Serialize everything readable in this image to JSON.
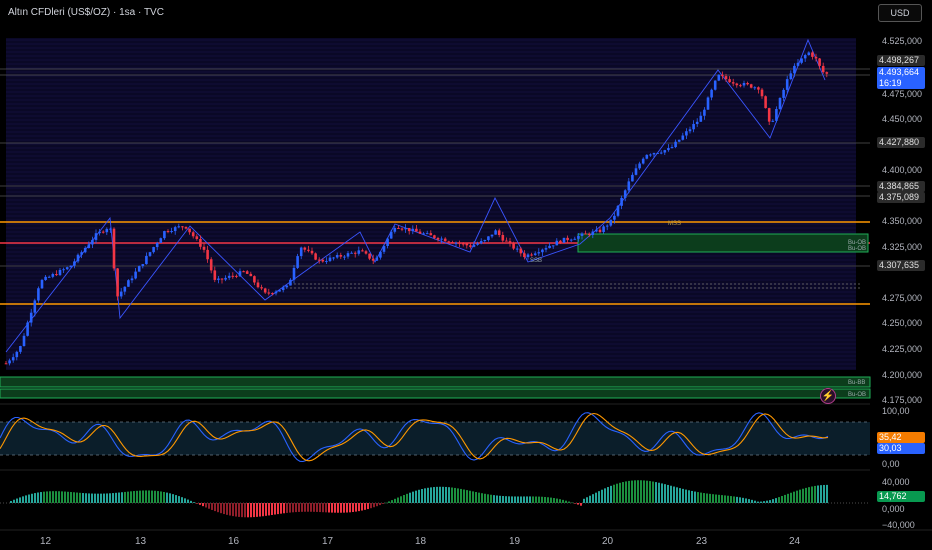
{
  "header": {
    "title": "Altın CFDleri (US$/OZ) · 1sa · TVC",
    "currency_button": "USD"
  },
  "price_axis": {
    "labels": [
      "4.525,000",
      "4.475,000",
      "4.450,000",
      "4.400,000",
      "4.350,000",
      "4.325,000",
      "4.275,000",
      "4.250,000",
      "4.225,000",
      "4.200,000",
      "4.175,000"
    ]
  },
  "price_tags": {
    "t1": "4.498,267",
    "t2": "4.493,664",
    "t2_time": "16:19",
    "t3": "4.427,880",
    "t4": "4.384,865",
    "t5": "4.375,089",
    "t6": "4.307,635"
  },
  "chart_labels": {
    "mss": "MSS",
    "bu_ob1": "Bu-OB",
    "bu_ob2": "Bu-OB",
    "bu_bb": "Bu-BB",
    "bu_ob3": "Bu-OB",
    "ssb": "SSB"
  },
  "stoch": {
    "axis": [
      "100,00",
      "0,00"
    ],
    "tag_k": "35,42",
    "tag_d": "30,03"
  },
  "macd": {
    "axis": [
      "40,000",
      "0,000",
      "−40,000"
    ],
    "tag": "14,762"
  },
  "time_axis": [
    "12",
    "13",
    "16",
    "17",
    "18",
    "19",
    "20",
    "23",
    "24"
  ],
  "colors": {
    "up": "#2962ff",
    "down": "#f23645",
    "orange": "#ff9800",
    "red": "#f23645",
    "green": "#089950"
  },
  "chart_data": {
    "type": "candlestick",
    "price_range": [
      4175,
      4530
    ],
    "key_levels": [
      4498.267,
      4493.664,
      4427.88,
      4384.865,
      4375.089,
      4307.635,
      4350,
      4330,
      4266
    ],
    "stoch_range": [
      0,
      100
    ],
    "macd_range": [
      -40,
      40
    ],
    "macd_last": 14.762
  }
}
